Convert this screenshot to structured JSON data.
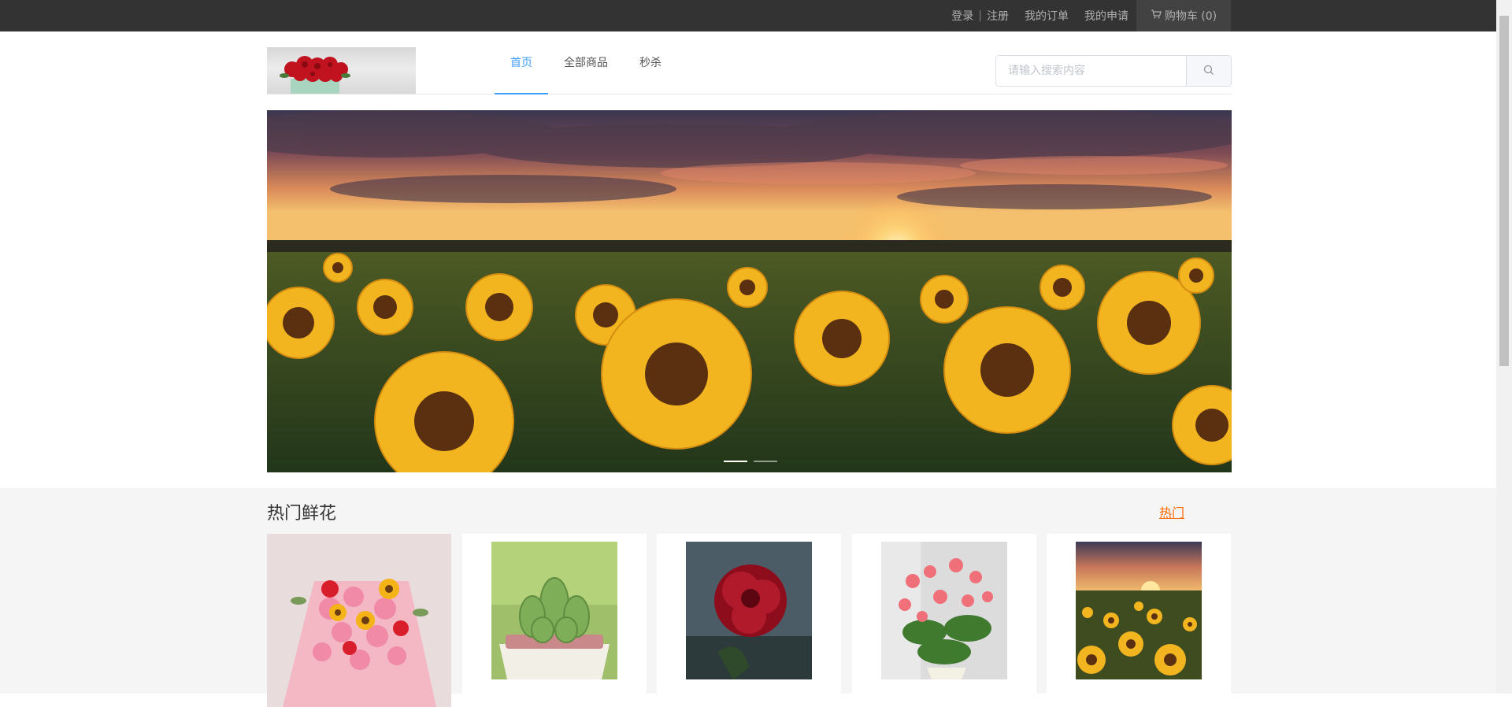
{
  "topbar": {
    "login": "登录",
    "separator": "|",
    "register": "注册",
    "my_orders": "我的订单",
    "my_applications": "我的申请",
    "cart_label": "购物车 (0)"
  },
  "nav": {
    "items": [
      {
        "label": "首页",
        "active": true
      },
      {
        "label": "全部商品",
        "active": false
      },
      {
        "label": "秒杀",
        "active": false
      }
    ]
  },
  "search": {
    "placeholder": "请输入搜索内容",
    "value": ""
  },
  "banner": {
    "slide_count": 2,
    "active_slide": 1
  },
  "section": {
    "title": "热门鲜花",
    "more_link": "热门"
  },
  "colors": {
    "topbar_bg": "#333333",
    "accent_blue": "#409eff",
    "accent_orange": "#ff6700",
    "section_bg": "#f5f5f5"
  },
  "icons": {
    "cart": "cart-icon",
    "search": "search-icon"
  }
}
